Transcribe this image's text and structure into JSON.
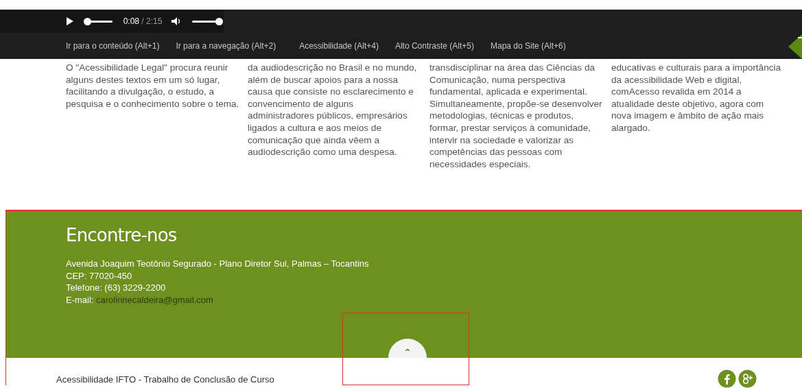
{
  "player": {
    "playing": false,
    "progress": {
      "level": 0.1
    },
    "current_time": "0:08",
    "duration": "/ 2:15",
    "volume": {
      "level": 1
    }
  },
  "nav_links": [
    {
      "label": "Ir para o conteúdo (Alt+1)"
    },
    {
      "label": "Ir para a navegação (Alt+2)"
    },
    {
      "label": "Acessibilidade (Alt+4)"
    },
    {
      "label": "Alto Contraste (Alt+5)"
    },
    {
      "label": "Mapa do Site (Alt+6)"
    }
  ],
  "columns": [
    {
      "text": "O \"Acessibilidade Legal\" procura reunir alguns destes textos em um só lugar, facilitando a divulgação, o estudo, a pesquisa e o conhecimento sobre o tema."
    },
    {
      "text": "da audiodescrição no Brasil e no mundo, além de buscar apoios para a nossa causa que consiste no esclarecimento e convencimento de alguns administradores públicos, empresários ligados a cultura e aos meios de comunicação que ainda vêem a audiodescrição como uma despesa."
    },
    {
      "text": "transdisciplinar na área das Ciências da Comunicação, numa perspectiva fundamental, aplicada e experimental. Simultaneamente, propõe-se desenvolver metodologias, técnicas e produtos, formar, prestar serviços à comunidade, intervir na sociedade e valorizar as competências das pessoas com necessidades especiais."
    },
    {
      "text": "educativas e culturais para a importância da acessibilidade Web e digital, comAcesso revalida em 2014 a atualidade deste objetivo, agora com nova imagem e âmbito de ação mais alargado."
    }
  ],
  "contact": {
    "title": "Encontre-nos",
    "address": "Avenida Joaquim Teotônio Segurado - Plano Diretor Sul, Palmas – Tocantins",
    "cep": "CEP: 77020-450",
    "phone": "Telefone: (63) 3229-2200",
    "email_label": "E-mail:",
    "email": "carolinnecaldeira@gmail.com"
  },
  "back_to_top": "^",
  "footer": {
    "text": "Acessibilidade IFTO - Trabalho de Conclusão de Curso",
    "social": [
      {
        "kind": "facebook"
      },
      {
        "kind": "googleplus"
      }
    ]
  }
}
